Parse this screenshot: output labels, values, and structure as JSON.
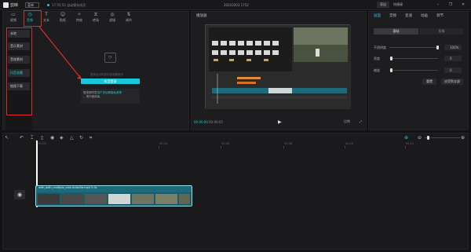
{
  "app": {
    "name": "剪映",
    "menu": "菜单",
    "save_status": "17:55:55 自动保存成功",
    "title": "20210203 1752",
    "export": "导出",
    "shortcut": "快捷键"
  },
  "top_tabs": [
    {
      "label": "视频",
      "icon": "video-icon"
    },
    {
      "label": "音频",
      "icon": "audio-icon"
    },
    {
      "label": "文本",
      "icon": "text-icon"
    },
    {
      "label": "贴纸",
      "icon": "sticker-icon"
    },
    {
      "label": "特效",
      "icon": "effects-icon"
    },
    {
      "label": "转场",
      "icon": "transition-icon"
    },
    {
      "label": "滤镜",
      "icon": "filter-icon"
    },
    {
      "label": "调节",
      "icon": "adjust-icon"
    }
  ],
  "sidebar": {
    "items": [
      "本地",
      "音乐素材",
      "音效素材",
      "抖音收藏",
      "链接下载"
    ]
  },
  "media_area": {
    "hint": "登录后可同步抖音收藏音乐",
    "login_button": "抖音登录",
    "info_prefix": "登录即同意",
    "user_agreement": "用户协议",
    "and": "和",
    "privacy_policy": "隐私政策",
    "info_suffix": "，请仔细阅读。"
  },
  "player": {
    "title": "播放器",
    "current_time": "00:00:00",
    "duration": "00:00:05",
    "ratio": "比例"
  },
  "properties": {
    "tabs": [
      "画面",
      "音频",
      "变速",
      "动画",
      "调节"
    ],
    "modes": [
      "基础",
      "抠像"
    ],
    "opacity_label": "不透明度",
    "opacity_value": "100%",
    "brightness_label": "亮度",
    "brightness_value": "0",
    "contrast_label": "缩放",
    "contrast_value": "0",
    "reset_button": "重置",
    "apply_all_button": "应用到全部"
  },
  "timeline": {
    "ticks": [
      "00:00",
      "00:04",
      "00:06",
      "00:08",
      "00:10",
      "00:12"
    ],
    "clip_label": "with_with_multiple_cats.rhdsd3d.mp4  5.0s",
    "cover_label": "封面"
  }
}
